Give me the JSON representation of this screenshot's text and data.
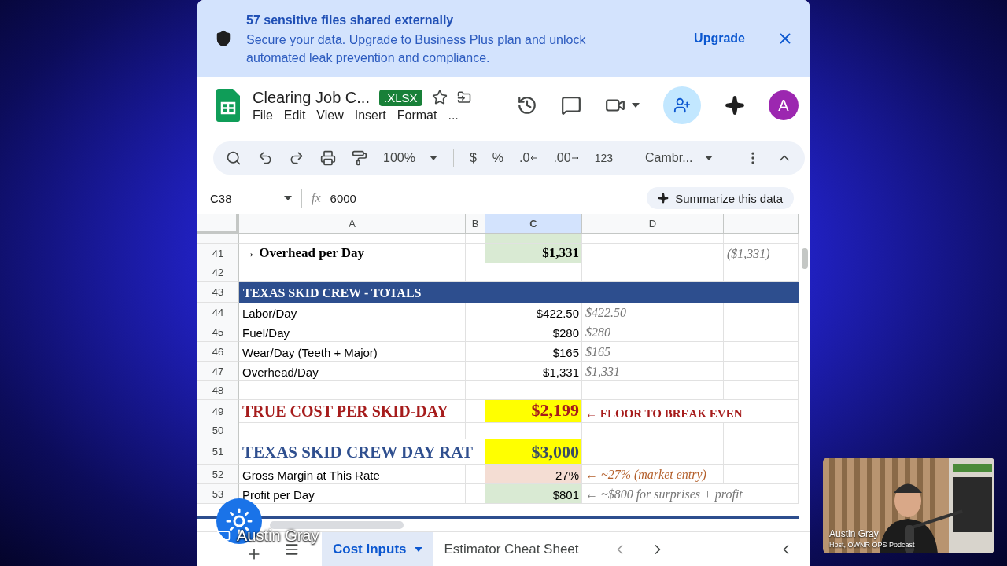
{
  "banner": {
    "title": "57 sensitive files shared externally",
    "message": "Secure your data. Upgrade to Business Plus plan and unlock automated leak prevention and compliance.",
    "action": "Upgrade"
  },
  "document": {
    "title": "Clearing Job C...",
    "badge": ".XLSX",
    "avatar": "A"
  },
  "menu": [
    "File",
    "Edit",
    "View",
    "Insert",
    "Format",
    "..."
  ],
  "toolbar": {
    "zoom": "100%",
    "currency": "$",
    "percent": "%",
    "decrease_decimals": ".0",
    "increase_decimals": ".00",
    "number_format": "123",
    "font": "Cambr..."
  },
  "formula_bar": {
    "cell_ref": "C38",
    "fx": "fx",
    "value": "6000",
    "summarize": "Summarize this data"
  },
  "columns": [
    {
      "label": "A",
      "selected": false
    },
    {
      "label": "B",
      "selected": false
    },
    {
      "label": "C",
      "selected": true
    },
    {
      "label": "D",
      "selected": false
    }
  ],
  "rows": [
    {
      "number": "41",
      "kind": "total",
      "a": {
        "text": "→ Overhead per Day"
      },
      "c": {
        "text": "$1,331",
        "color": "#d9ead3"
      },
      "e": {
        "text": "($1,331)",
        "kind": "muted"
      }
    },
    {
      "number": "42",
      "kind": "blank"
    },
    {
      "number": "43",
      "kind": "section",
      "a": {
        "text": "TEXAS SKID CREW - TOTALS"
      }
    },
    {
      "number": "44",
      "kind": "item",
      "a": {
        "text": "Labor/Day"
      },
      "c": {
        "text": "$422.50"
      },
      "d": {
        "text": "$422.50",
        "kind": "muted"
      }
    },
    {
      "number": "45",
      "kind": "item",
      "a": {
        "text": "Fuel/Day"
      },
      "c": {
        "text": "$280"
      },
      "d": {
        "text": "$280",
        "kind": "muted"
      }
    },
    {
      "number": "46",
      "kind": "item",
      "a": {
        "text": "Wear/Day (Teeth + Major)"
      },
      "c": {
        "text": "$165"
      },
      "d": {
        "text": "$165",
        "kind": "muted"
      }
    },
    {
      "number": "47",
      "kind": "item",
      "a": {
        "text": "Overhead/Day"
      },
      "c": {
        "text": "$1,331"
      },
      "d": {
        "text": "$1,331",
        "kind": "muted"
      }
    },
    {
      "number": "48",
      "kind": "blank"
    },
    {
      "number": "49",
      "kind": "cost",
      "a": {
        "text": "TRUE COST PER SKID-DAY"
      },
      "c": {
        "text": "$2,199",
        "color": "#ffff00"
      },
      "d": {
        "text": "← FLOOR TO BREAK EVEN",
        "kind": "alert"
      }
    },
    {
      "number": "50",
      "kind": "blank"
    },
    {
      "number": "51",
      "kind": "rate",
      "a": {
        "text": "TEXAS SKID CREW DAY RAT"
      },
      "c": {
        "text": "$3,000",
        "color": "#ffff00"
      }
    },
    {
      "number": "52",
      "kind": "item",
      "a": {
        "text": "Gross Margin at This Rate"
      },
      "c": {
        "text": "27%",
        "color": "#f4ddd3"
      },
      "d": {
        "text": "← ~27% (market entry)",
        "kind": "warning"
      }
    },
    {
      "number": "53",
      "kind": "item",
      "a": {
        "text": "Profit per Day"
      },
      "c": {
        "text": "$801",
        "color": "#d9ead3"
      },
      "d": {
        "text": "← ~$800 for surprises + profit",
        "kind": "muted"
      }
    }
  ],
  "sheet_tabs": [
    {
      "label": "Cost Inputs",
      "selected": true
    },
    {
      "label": "Estimator Cheat Sheet",
      "selected": false
    }
  ],
  "presenter": {
    "name": "Austin Gray"
  },
  "video": {
    "name": "Austin Gray",
    "role": "Host, OWNR OPS Podcast"
  }
}
